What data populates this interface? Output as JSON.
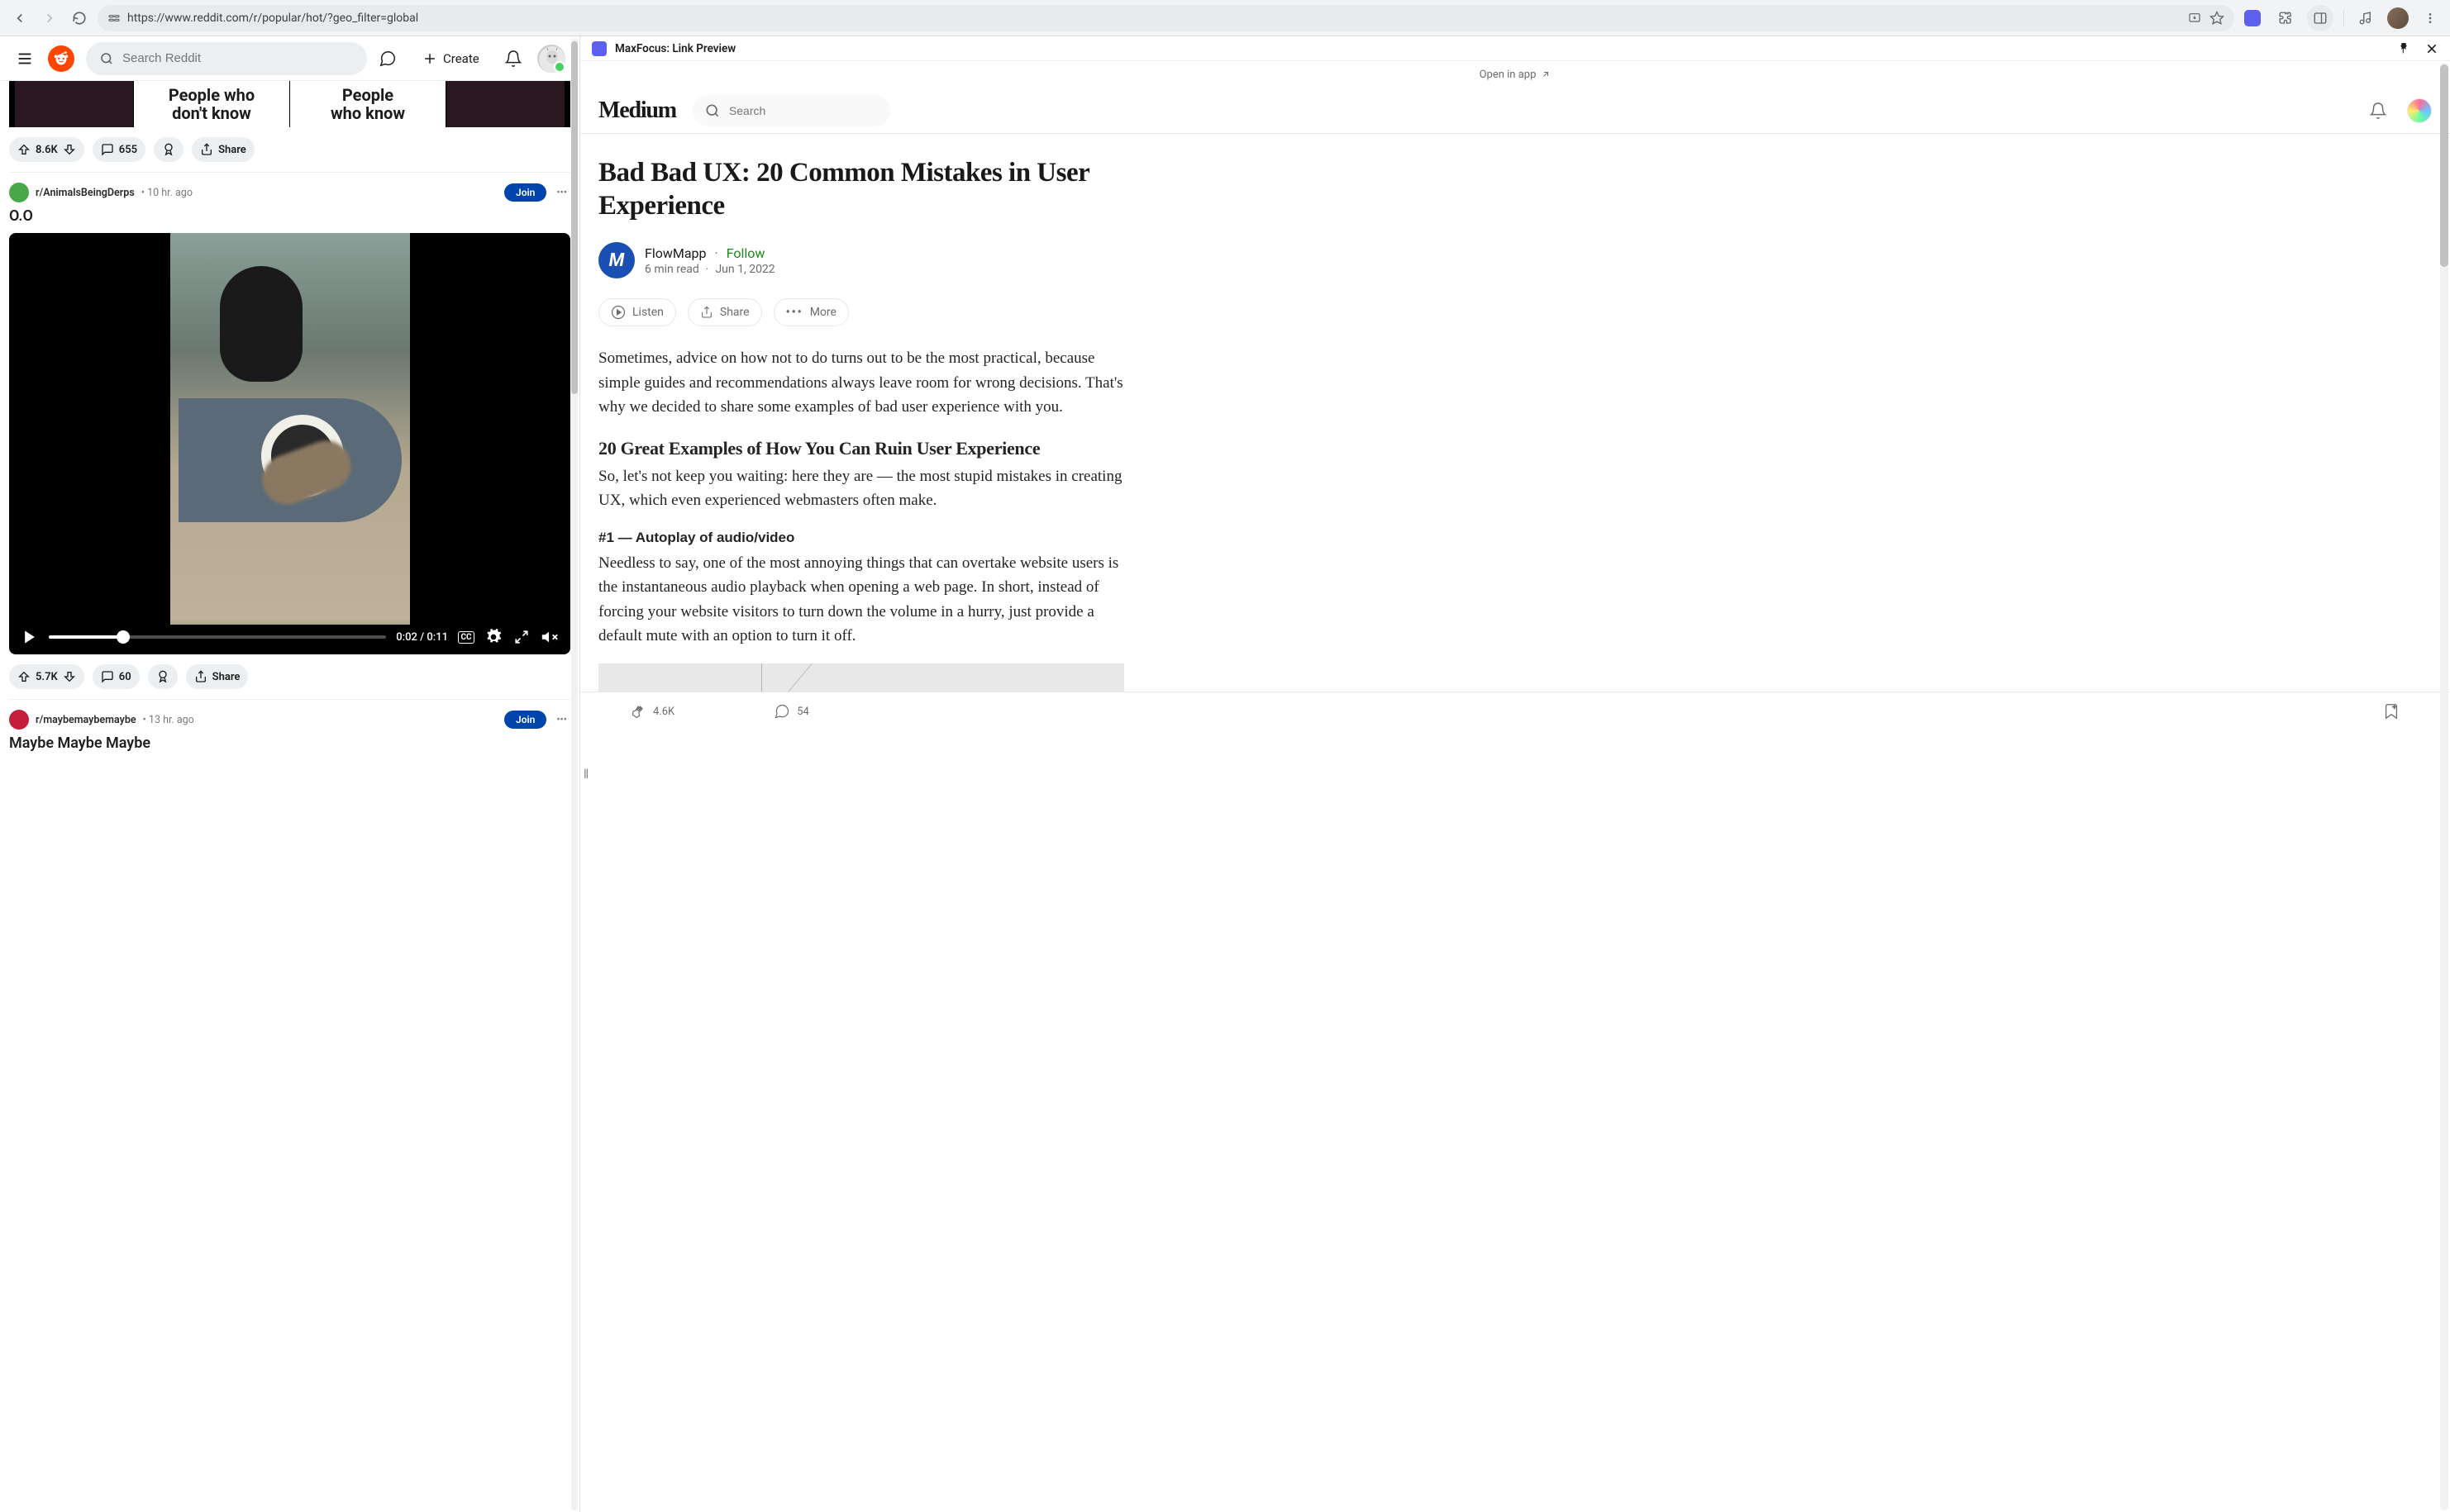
{
  "browser": {
    "url": "https://www.reddit.com/r/popular/hot/?geo_filter=global"
  },
  "reddit": {
    "search_placeholder": "Search Reddit",
    "create_label": "Create",
    "partial_post": {
      "left_text1": "People who",
      "left_text2": "don't know",
      "right_text1": "People",
      "right_text2": "who know",
      "votes": "8.6K",
      "comments": "655",
      "share": "Share"
    },
    "post2": {
      "subreddit": "r/AnimalsBeingDerps",
      "time": "10 hr. ago",
      "join": "Join",
      "title": "O.O",
      "video_time": "0:02 / 0:11",
      "votes": "5.7K",
      "comments": "60",
      "share": "Share"
    },
    "post3": {
      "subreddit": "r/maybemaybemaybe",
      "time": "13 hr. ago",
      "join": "Join",
      "title": "Maybe Maybe Maybe"
    }
  },
  "extension": {
    "title": "MaxFocus: Link Preview"
  },
  "medium": {
    "open_app": "Open in app",
    "logo": "Medium",
    "search_placeholder": "Search",
    "article": {
      "title": "Bad Bad UX: 20 Common Mistakes in User Experience",
      "author": "FlowMapp",
      "follow": "Follow",
      "read_time": "6 min read",
      "date": "Jun 1, 2022",
      "listen": "Listen",
      "share": "Share",
      "more": "More",
      "p1": "Sometimes, advice on how not to do turns out to be the most practical, because simple guides and recommendations always leave room for wrong decisions. That's why we decided to share some examples of bad user experience with you.",
      "h2": "20 Great Examples of How You Can Ruin User Experience",
      "p2": "So, let's not keep you waiting: here they are — the most stupid mistakes in creating UX, which even experienced webmasters often make.",
      "h3": "#1 — Autoplay of audio/video",
      "p3": "Needless to say, one of the most annoying things that can overtake website users is the instantaneous audio playback when opening a web page. In short, instead of forcing your website visitors to turn down the volume in a hurry, just provide a default mute with an option to turn it off.",
      "claps": "4.6K",
      "responses": "54"
    }
  }
}
